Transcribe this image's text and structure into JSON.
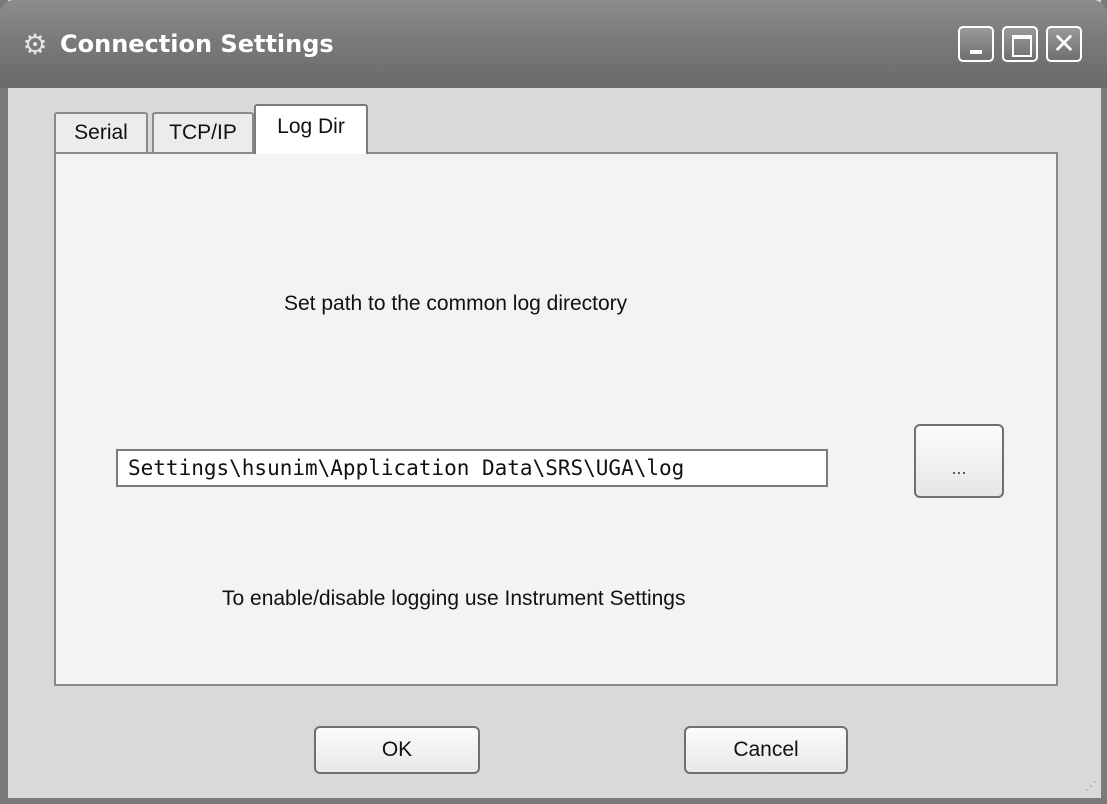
{
  "window": {
    "title": "Connection Settings",
    "icon": "gear-icon",
    "controls": {
      "minimize": "minimize-icon",
      "maximize": "maximize-icon",
      "close": "close-icon"
    }
  },
  "tabs": [
    {
      "label": "Serial",
      "active": false
    },
    {
      "label": "TCP/IP",
      "active": false
    },
    {
      "label": "Log Dir",
      "active": true
    }
  ],
  "log_dir": {
    "instruction": "Set path to the common log directory",
    "path_value": "Settings\\hsunim\\Application Data\\SRS\\UGA\\log",
    "browse_label": "...",
    "note": "To enable/disable logging use Instrument Settings"
  },
  "buttons": {
    "ok": "OK",
    "cancel": "Cancel"
  }
}
